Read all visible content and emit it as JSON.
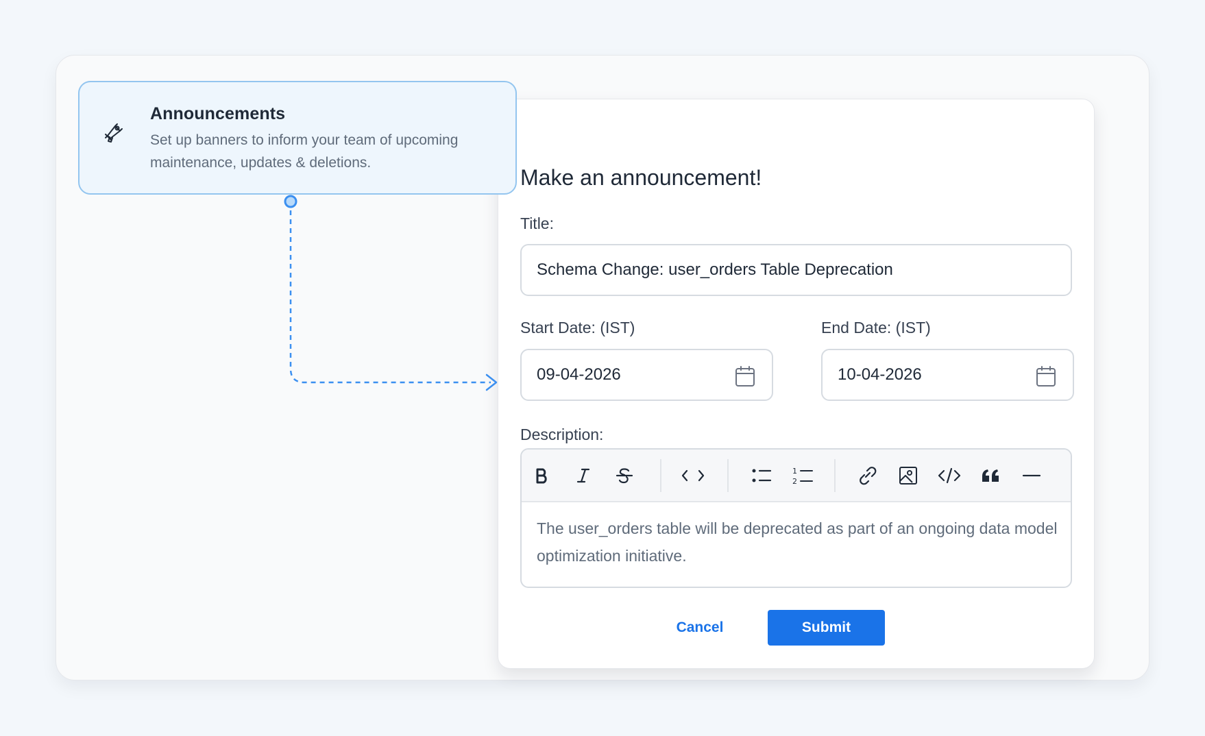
{
  "announcements_card": {
    "icon": "megaphone-icon",
    "title": "Announcements",
    "description": "Set up banners to inform your team of upcoming maintenance, updates & deletions."
  },
  "modal": {
    "heading": "Make an announcement!",
    "title_label": "Title:",
    "title_value": "Schema Change: user_orders Table Deprecation",
    "start_label": "Start Date: (IST)",
    "start_value": "09-04-2026",
    "end_label": "End Date: (IST)",
    "end_value": "10-04-2026",
    "description_label": "Description:",
    "description_text": "The user_orders table will be deprecated as part of an ongoing data model optimization initiative.",
    "toolbar": [
      {
        "name": "bold-icon",
        "label": "B"
      },
      {
        "name": "italic-icon",
        "label": "I"
      },
      {
        "name": "strikethrough-icon",
        "label": "S"
      },
      {
        "name": "inline-code-icon",
        "label": "< >"
      },
      {
        "name": "bullet-list-icon",
        "label": ""
      },
      {
        "name": "numbered-list-icon",
        "label": ""
      },
      {
        "name": "link-icon",
        "label": ""
      },
      {
        "name": "image-icon",
        "label": ""
      },
      {
        "name": "code-block-icon",
        "label": "</>"
      },
      {
        "name": "blockquote-icon",
        "label": ""
      },
      {
        "name": "horizontal-rule-icon",
        "label": ""
      }
    ],
    "cancel_label": "Cancel",
    "submit_label": "Submit"
  },
  "colors": {
    "accent": "#1a73e8",
    "connector": "#3b8ff0",
    "card_bg": "#eef6fd",
    "card_border": "#93c5ef"
  }
}
